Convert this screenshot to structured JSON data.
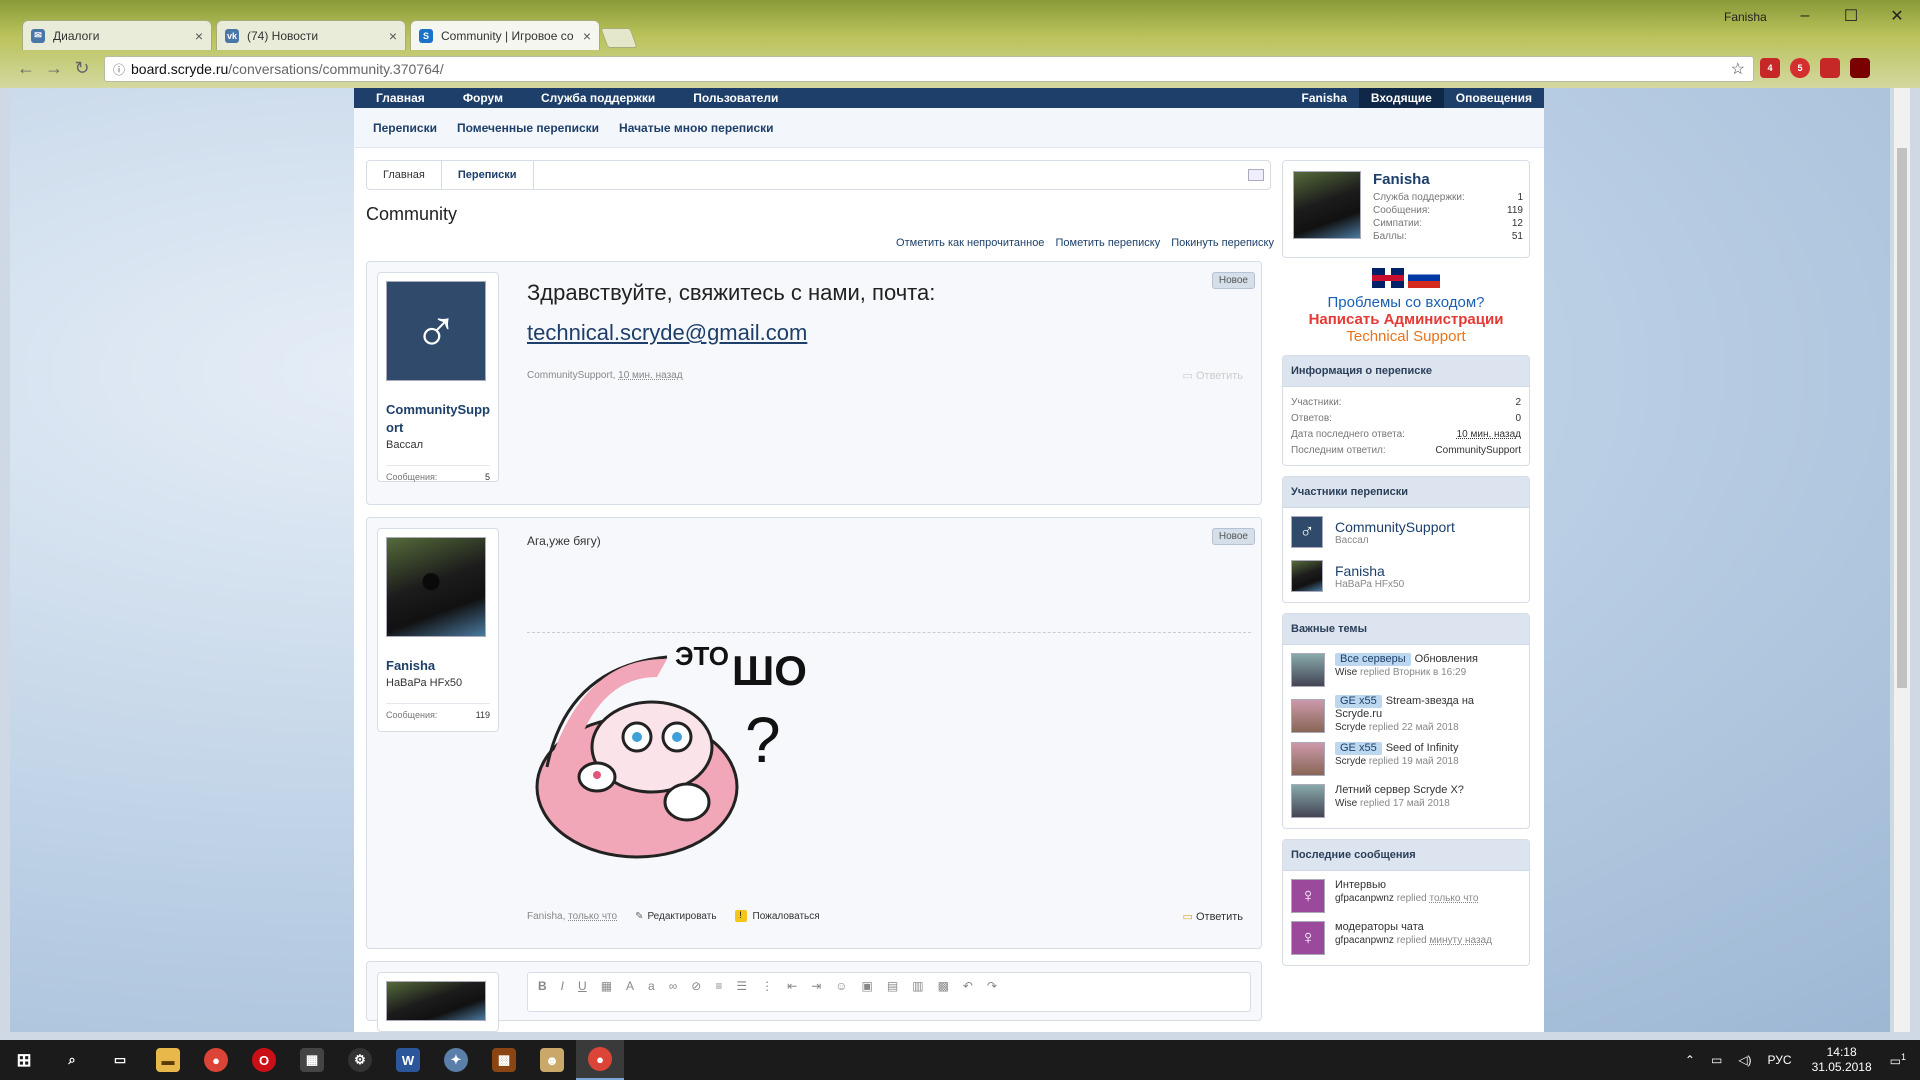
{
  "browser": {
    "tabs": [
      {
        "label": "Диалоги",
        "icon": "vk-dialogs-icon",
        "color": "#4a76a8"
      },
      {
        "label": "(74) Новости",
        "icon": "vk-icon",
        "color": "#4a76a8"
      },
      {
        "label": "Community | Игровое со",
        "icon": "scryde-icon",
        "color": "#1a73c8"
      }
    ],
    "user": "Fanisha",
    "url_host": "board.scryde.ru",
    "url_path": "/conversations/community.370764/",
    "extensions": [
      {
        "badge": "4",
        "color": "#c62828"
      },
      {
        "badge": "5",
        "color": "#d32f2f"
      },
      {
        "badge": "",
        "color": "#c62828"
      },
      {
        "badge": "",
        "color": "#7a0000"
      }
    ]
  },
  "site": {
    "nav_left": [
      "Главная",
      "Форум",
      "Служба поддержки",
      "Пользователи"
    ],
    "nav_right": [
      "Fanisha",
      "Входящие",
      "Оповещения"
    ],
    "subnav": [
      "Переписки",
      "Помеченные переписки",
      "Начатые мною переписки"
    ],
    "breadcrumb": [
      "Главная",
      "Переписки"
    ],
    "title": "Community",
    "conv_actions": [
      "Отметить как непрочитанное",
      "Пометить переписку",
      "Покинуть переписку"
    ]
  },
  "messages": [
    {
      "author": "CommunitySupport",
      "user_title": "Вассал",
      "stats_label": "Сообщения:",
      "stats_value": "5",
      "badge": "Новое",
      "line1": "Здравствуйте, свяжитесь с нами, почта:",
      "email": "technical.scryde@gmail.com",
      "meta_author": "CommunitySupport",
      "meta_time": "10 мин. назад",
      "reply": "Ответить"
    },
    {
      "author": "Fanisha",
      "user_title": "НаВаРа HFx50",
      "stats_label": "Сообщения:",
      "stats_value": "119",
      "badge": "Новое",
      "text": "Ага,уже бягу)",
      "sticker_text1": "ЭТО",
      "sticker_text2": "ШО",
      "sticker_text3": "?",
      "meta_author": "Fanisha",
      "meta_time": "только что",
      "edit": "Редактировать",
      "report": "Пожаловаться",
      "reply": "Ответить"
    }
  ],
  "sidebar": {
    "profile": {
      "name": "Fanisha",
      "stats": [
        {
          "label": "Служба поддержки:",
          "value": "1"
        },
        {
          "label": "Сообщения:",
          "value": "119"
        },
        {
          "label": "Симпатии:",
          "value": "12"
        },
        {
          "label": "Баллы:",
          "value": "51"
        }
      ]
    },
    "login_help": "Проблемы со входом?",
    "admin": "Написать Администрации",
    "tech": "Technical Support",
    "conv_info": {
      "title": "Информация о переписке",
      "rows": [
        {
          "label": "Участники:",
          "value": "2"
        },
        {
          "label": "Ответов:",
          "value": "0"
        },
        {
          "label": "Дата последнего ответа:",
          "value": "10 мин. назад"
        },
        {
          "label": "Последним ответил:",
          "value": "CommunitySupport"
        }
      ]
    },
    "participants": {
      "title": "Участники переписки",
      "items": [
        {
          "name": "CommunitySupport",
          "title": "Вассал"
        },
        {
          "name": "Fanisha",
          "title": "НаВаРа HFx50"
        }
      ]
    },
    "important": {
      "title": "Важные темы",
      "items": [
        {
          "tag": "Все серверы",
          "title": "Обновления",
          "author": "Wise",
          "time": "Вторник в 16:29"
        },
        {
          "tag": "GE x55",
          "title": "Stream-звезда на Scryde.ru",
          "author": "Scryde",
          "time": "22 май 2018"
        },
        {
          "tag": "GE x55",
          "title": "Seed of Infinity",
          "author": "Scryde",
          "time": "19 май 2018"
        },
        {
          "tag": "",
          "title": "Летний сервер Scryde X?",
          "author": "Wise",
          "time": "17 май 2018"
        }
      ]
    },
    "recent": {
      "title": "Последние сообщения",
      "items": [
        {
          "title": "Интервью",
          "author": "gfpacanpwnz",
          "time": "только что"
        },
        {
          "title": "модераторы чата",
          "author": "gfpacanpwnz",
          "time": "минуту назад"
        }
      ]
    },
    "replied_word": "replied"
  },
  "taskbar": {
    "lang": "РУС",
    "time": "14:18",
    "date": "31.05.2018",
    "notif": "1"
  },
  "colors": {
    "nav": "#1d3f6a",
    "admin_red": "#e53935",
    "support_blue": "#1a5fb4",
    "tech_orange": "#e8731a"
  }
}
